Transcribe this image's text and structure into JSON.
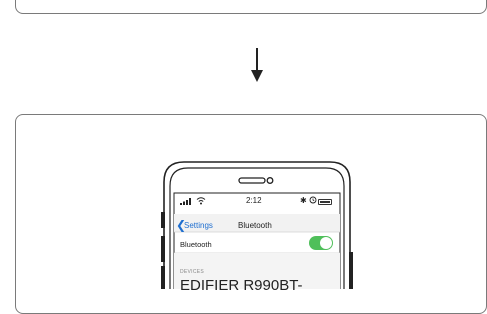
{
  "phone": {
    "status_bar": {
      "time": "2:12",
      "bluetooth_glyph": "✱"
    },
    "nav": {
      "back_icon": "❮",
      "back_label": "Settings",
      "title": "Bluetooth"
    },
    "bluetooth_row": {
      "label": "Bluetooth",
      "toggle_on": true
    },
    "devices_section": {
      "header": "DEVICES",
      "device_name": "EDIFIER R990BT-"
    }
  },
  "colors": {
    "toggle_on": "#4fbf5a",
    "ios_blue": "#1f6fd0",
    "outline": "#7a7a7a"
  },
  "icons": [
    "down-arrow-icon",
    "signal-icon",
    "wifi-icon",
    "bluetooth-icon",
    "alarm-icon",
    "battery-icon",
    "chevron-left-icon"
  ]
}
